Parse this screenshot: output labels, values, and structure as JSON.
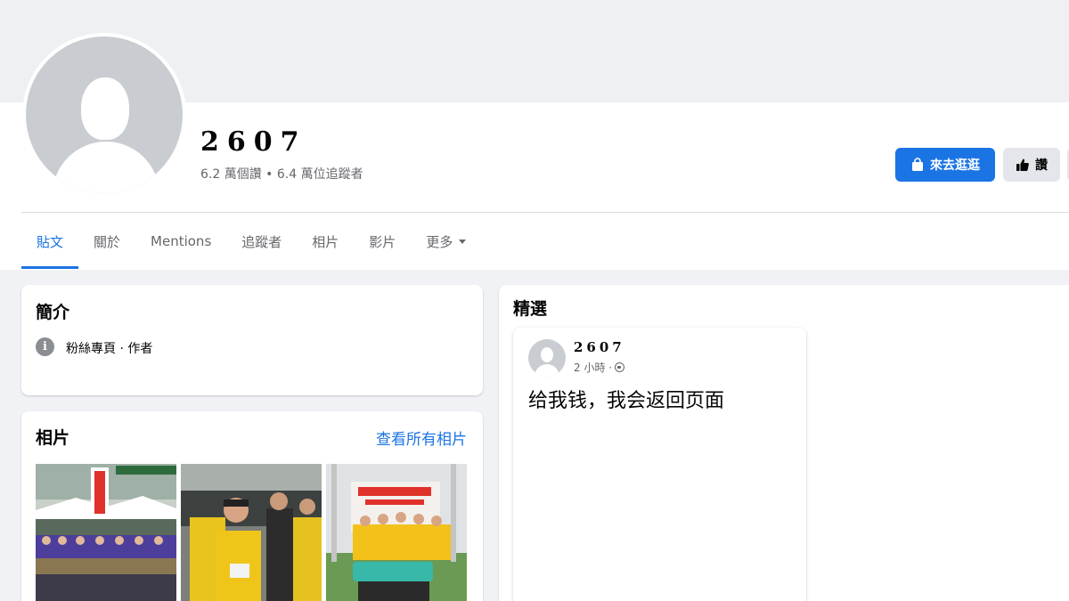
{
  "profile": {
    "name": "2607",
    "stats": "6.2 萬個讚 • 6.4 萬位追蹤者"
  },
  "actions": {
    "primary_label": "來去逛逛",
    "like_label": "讚"
  },
  "tabs": [
    {
      "label": "貼文",
      "active": true
    },
    {
      "label": "關於"
    },
    {
      "label": "Mentions"
    },
    {
      "label": "追蹤者"
    },
    {
      "label": "相片"
    },
    {
      "label": "影片"
    },
    {
      "label": "更多"
    }
  ],
  "intro": {
    "title": "簡介",
    "category": "粉絲專頁 · 作者"
  },
  "photos": {
    "title": "相片",
    "see_all": "查看所有相片"
  },
  "featured": {
    "title": "精選",
    "post": {
      "author": "2607",
      "time": "2 小時 ·",
      "text": "给我钱，我会返回页面"
    }
  },
  "colors": {
    "accent": "#1b74e4",
    "background": "#f0f2f5",
    "secondary_text": "#65676b"
  }
}
